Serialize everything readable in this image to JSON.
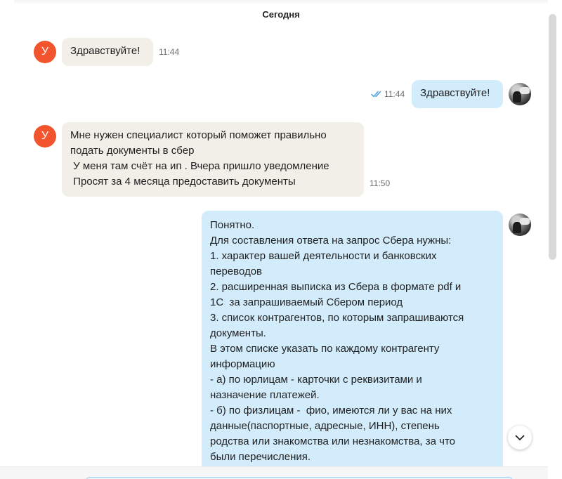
{
  "date_divider": "Сегодня",
  "contact_initial": "У",
  "messages": [
    {
      "text": "Здравствуйте!",
      "time": "11:44"
    },
    {
      "text": "Здравствуйте!",
      "time": "11:44"
    },
    {
      "text": "Мне нужен специалист который поможет правильно\nподать документы в сбер\n У меня там счёт на ип . Вчера пришло уведомление\n Просят за 4 месяца предоставить документы",
      "time": "11:50"
    },
    {
      "text": "Понятно.\nДля составления ответа на запрос Сбера нужны:\n1. характер вашей деятельности и банковских\nпереводов\n2. расширенная выписка из Сбера в формате pdf и\n1С  за запрашиваемый Сбером период\n3. список контрагентов, по которым запрашиваются\nдокументы.\nВ этом списке указать по каждому контрагенту\nинформацию\n- а) по юрлицам - карточки с реквизитами и\nназначение платежей.\n- б) по физлицам -  фио, имеются ли у вас на них\nданные(паспортные, адресные, ИНН), степень\nродства или знакомства или незнакомства, за что\nбыли перечисления."
    }
  ],
  "colors": {
    "avatar": "#f2542d",
    "incoming_bubble": "#f2efe9",
    "outgoing_bubble": "#d3ecfc",
    "read_ticks": "#3a9be0"
  }
}
